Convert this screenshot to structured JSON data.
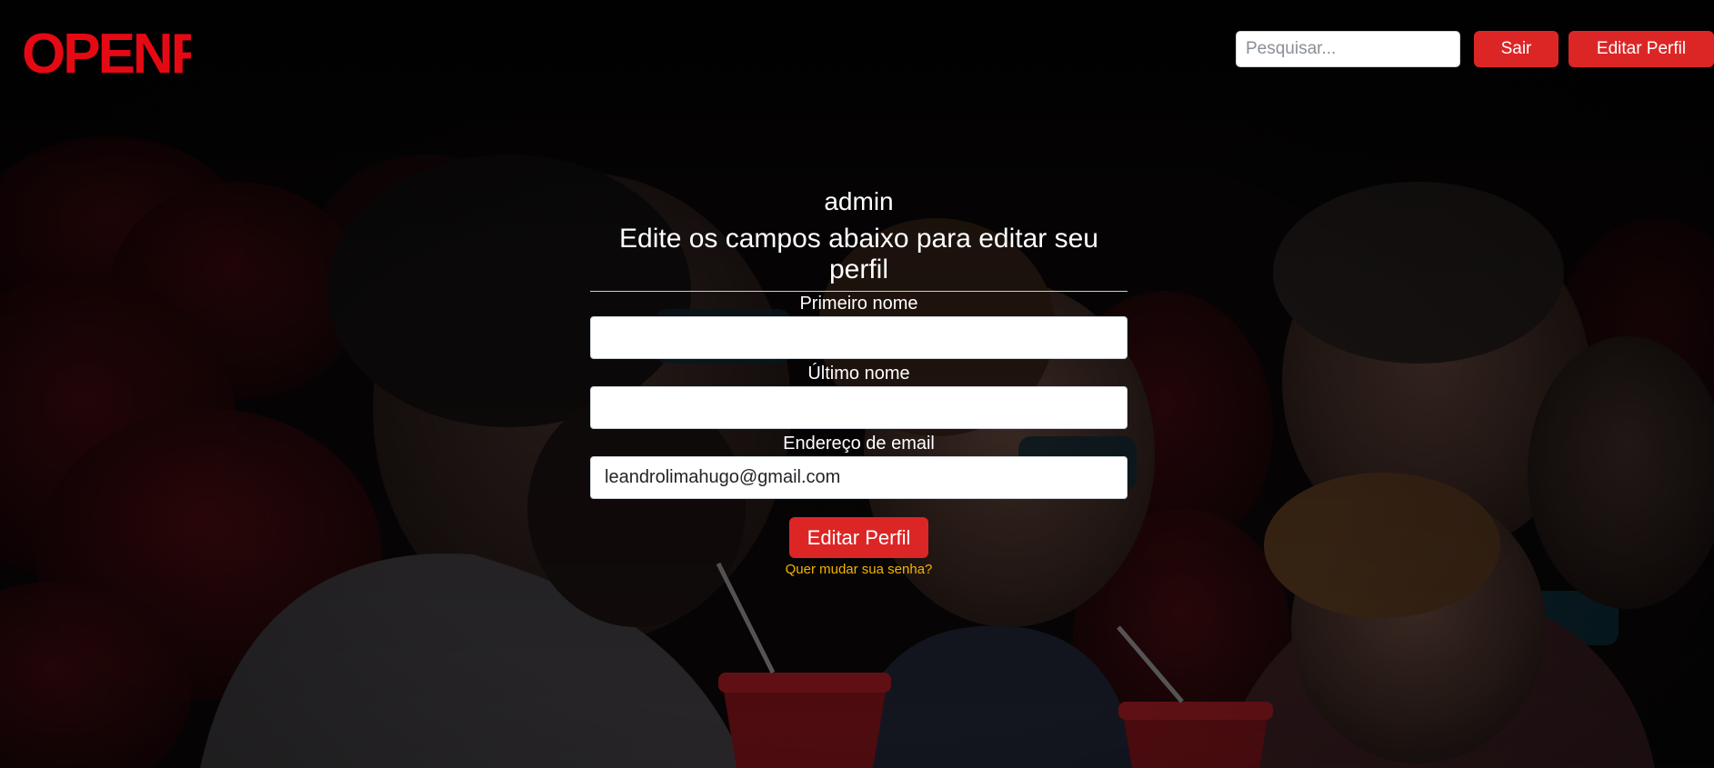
{
  "header": {
    "logo_text": "OPENFLIX",
    "search": {
      "placeholder": "Pesquisar...",
      "value": ""
    },
    "logout_label": "Sair",
    "edit_profile_label": "Editar Perfil"
  },
  "profile_form": {
    "username": "admin",
    "subtitle": "Edite os campos abaixo para editar seu perfil",
    "first_name": {
      "label": "Primeiro nome",
      "value": ""
    },
    "last_name": {
      "label": "Último nome",
      "value": ""
    },
    "email": {
      "label": "Endereço de email",
      "value": "leandrolimahugo@gmail.com"
    },
    "submit_label": "Editar Perfil",
    "change_password_link": "Quer mudar sua senha?"
  },
  "colors": {
    "brand_red": "#e50914",
    "button_red": "#dc2626",
    "link_yellow": "#f5b400",
    "background": "#070507"
  },
  "background_image": "darkened cinema audience wearing 3D glasses with popcorn cups"
}
